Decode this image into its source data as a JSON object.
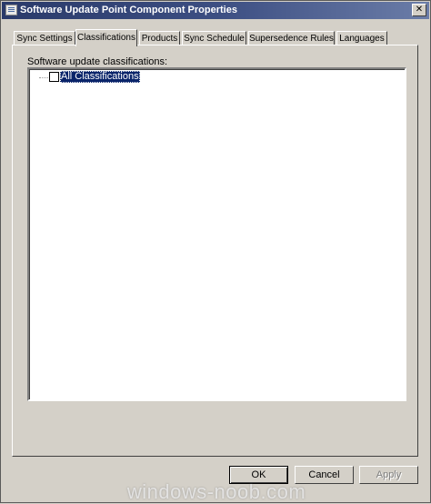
{
  "window": {
    "title": "Software Update Point Component Properties",
    "close_glyph": "✕"
  },
  "tabs": [
    {
      "label": "Sync Settings",
      "active": false
    },
    {
      "label": "Classifications",
      "active": true
    },
    {
      "label": "Products",
      "active": false
    },
    {
      "label": "Sync Schedule",
      "active": false
    },
    {
      "label": "Supersedence Rules",
      "active": false
    },
    {
      "label": "Languages",
      "active": false
    }
  ],
  "classifications": {
    "label": "Software update classifications:",
    "tree_items": [
      {
        "label": "All Classifications",
        "checked": false,
        "selected": true
      }
    ]
  },
  "buttons": {
    "ok": "OK",
    "cancel": "Cancel",
    "apply": "Apply"
  },
  "watermark": "windows-noob.com",
  "colors": {
    "titlebar": "#2a3a6a",
    "selection": "#0a246a",
    "face": "#d4d0c8"
  },
  "icons": {
    "app": "properties-window-icon",
    "close": "close-icon"
  }
}
